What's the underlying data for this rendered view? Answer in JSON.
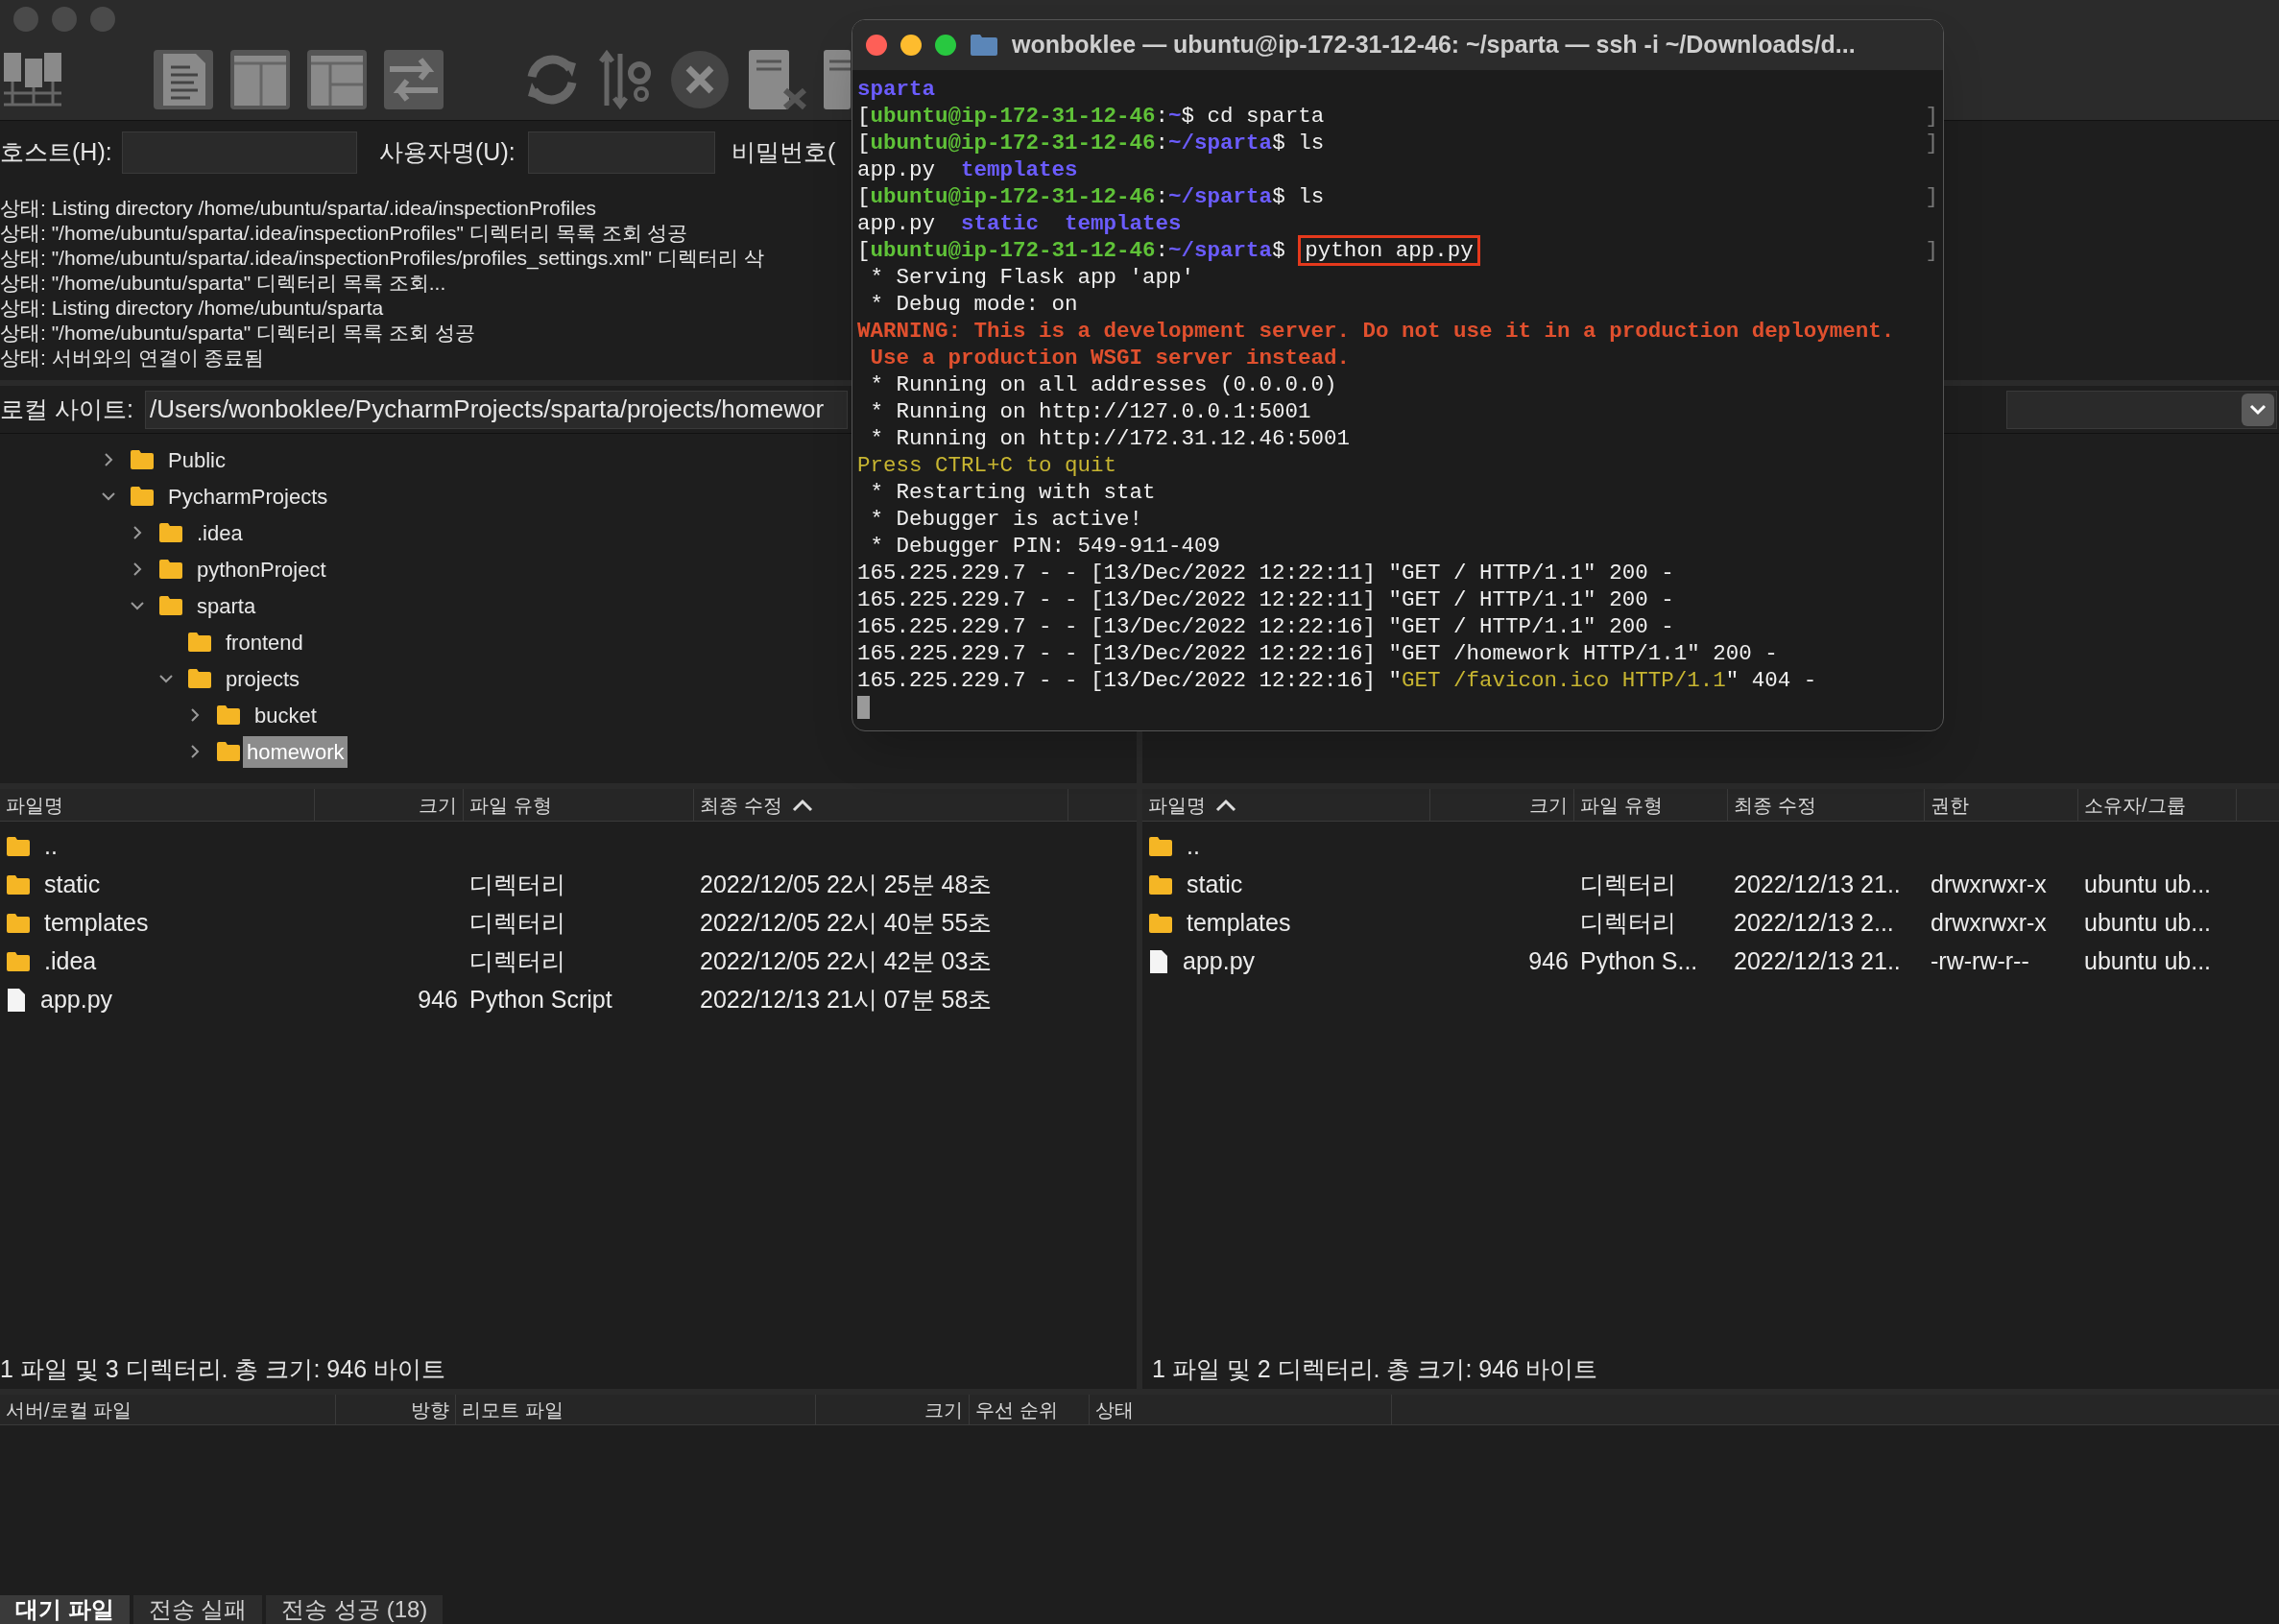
{
  "quickconnect": {
    "host_label": "호스트(H):",
    "user_label": "사용자명(U):",
    "password_label": "비밀번호("
  },
  "log": [
    "상태:  Listing directory /home/ubuntu/sparta/.idea/inspectionProfiles",
    "상태:  \"/home/ubuntu/sparta/.idea/inspectionProfiles\" 디렉터리 목록 조회 성공",
    "상태:  \"/home/ubuntu/sparta/.idea/inspectionProfiles/profiles_settings.xml\" 디렉터리 삭",
    "상태:  \"/home/ubuntu/sparta\" 디렉터리 목록 조회...",
    "상태:  Listing directory /home/ubuntu/sparta",
    "상태:  \"/home/ubuntu/sparta\" 디렉터리 목록 조회 성공",
    "상태:  서버와의 연결이 종료됨"
  ],
  "local_site": {
    "label": "로컬 사이트:",
    "path": "/Users/wonboklee/PycharmProjects/sparta/projects/homewor"
  },
  "local_tree": [
    {
      "name": "Public",
      "expanded": false,
      "selected": false
    },
    {
      "name": "PycharmProjects",
      "expanded": true,
      "selected": false,
      "children": [
        {
          "name": ".idea",
          "expanded": false,
          "selected": false
        },
        {
          "name": "pythonProject",
          "expanded": false,
          "selected": false
        },
        {
          "name": "sparta",
          "expanded": true,
          "selected": false,
          "children": [
            {
              "name": "frontend",
              "selected": false
            },
            {
              "name": "projects",
              "expanded": true,
              "selected": false,
              "children": [
                {
                  "name": "bucket",
                  "expanded": false,
                  "selected": false
                },
                {
                  "name": "homework",
                  "expanded": false,
                  "selected": true
                }
              ]
            }
          ]
        }
      ]
    }
  ],
  "local_files": {
    "columns": [
      {
        "label": "파일명",
        "sorted": false
      },
      {
        "label": "크기",
        "sorted": false
      },
      {
        "label": "파일 유형",
        "sorted": false
      },
      {
        "label": "최종 수정",
        "sorted": true
      }
    ],
    "rows": [
      {
        "kind": "folder",
        "cells": [
          ".."
        ]
      },
      {
        "kind": "folder",
        "cells": [
          "static",
          "",
          "디렉터리",
          "2022/12/05 22시 25분 48초"
        ]
      },
      {
        "kind": "folder",
        "cells": [
          "templates",
          "",
          "디렉터리",
          "2022/12/05 22시 40분 55초"
        ]
      },
      {
        "kind": "folder",
        "cells": [
          ".idea",
          "",
          "디렉터리",
          "2022/12/05 22시 42분 03초"
        ]
      },
      {
        "kind": "file",
        "cells": [
          "app.py",
          "946",
          "Python Script",
          "2022/12/13 21시 07분 58초"
        ]
      }
    ],
    "status": "1 파일 및 3 디렉터리. 총 크기: 946 바이트"
  },
  "remote_files": {
    "columns": [
      {
        "label": "파일명",
        "sorted": true
      },
      {
        "label": "크기",
        "sorted": false
      },
      {
        "label": "파일 유형",
        "sorted": false
      },
      {
        "label": "최종 수정",
        "sorted": false
      },
      {
        "label": "권한",
        "sorted": false
      },
      {
        "label": "소유자/그룹",
        "sorted": false
      }
    ],
    "rows": [
      {
        "kind": "folder",
        "cells": [
          ".."
        ]
      },
      {
        "kind": "folder",
        "cells": [
          "static",
          "",
          "디렉터리",
          "2022/12/13 21..",
          "drwxrwxr-x",
          "ubuntu ub..."
        ]
      },
      {
        "kind": "folder",
        "cells": [
          "templates",
          "",
          "디렉터리",
          "2022/12/13 2...",
          "drwxrwxr-x",
          "ubuntu ub..."
        ]
      },
      {
        "kind": "file",
        "cells": [
          "app.py",
          "946",
          "Python S...",
          "2022/12/13 21..",
          "-rw-rw-r--",
          "ubuntu ub..."
        ]
      }
    ],
    "status": "1 파일 및 2 디렉터리. 총 크기: 946 바이트"
  },
  "queue": {
    "columns": [
      "서버/로컬 파일",
      "방향",
      "리모트 파일",
      "크기",
      "우선 순위",
      "상태"
    ],
    "tabs": [
      {
        "label": "대기 파일",
        "selected": true
      },
      {
        "label": "전송 실패",
        "selected": false
      },
      {
        "label": "전송 성공 (18)",
        "selected": false
      }
    ]
  },
  "terminal": {
    "title": "wonboklee — ubuntu@ip-172-31-12-46: ~/sparta — ssh -i ~/Downloads/d...",
    "lines": [
      {
        "segments": [
          {
            "text": "sparta",
            "kind": "dir"
          }
        ]
      },
      {
        "end": "]",
        "segments": [
          {
            "text": "[",
            "kind": "plain"
          },
          {
            "text": "ubuntu@ip-172-31-12-46",
            "kind": "user"
          },
          {
            "text": ":",
            "kind": "plain"
          },
          {
            "text": "~",
            "kind": "dir"
          },
          {
            "text": "$ cd sparta",
            "kind": "plain"
          }
        ]
      },
      {
        "end": "]",
        "segments": [
          {
            "text": "[",
            "kind": "plain"
          },
          {
            "text": "ubuntu@ip-172-31-12-46",
            "kind": "user"
          },
          {
            "text": ":",
            "kind": "plain"
          },
          {
            "text": "~/sparta",
            "kind": "dir"
          },
          {
            "text": "$ ls",
            "kind": "plain"
          }
        ]
      },
      {
        "segments": [
          {
            "text": "app.py  ",
            "kind": "plain"
          },
          {
            "text": "templates",
            "kind": "dir"
          }
        ]
      },
      {
        "end": "]",
        "segments": [
          {
            "text": "[",
            "kind": "plain"
          },
          {
            "text": "ubuntu@ip-172-31-12-46",
            "kind": "user"
          },
          {
            "text": ":",
            "kind": "plain"
          },
          {
            "text": "~/sparta",
            "kind": "dir"
          },
          {
            "text": "$ ls",
            "kind": "plain"
          }
        ]
      },
      {
        "segments": [
          {
            "text": "app.py  ",
            "kind": "plain"
          },
          {
            "text": "static",
            "kind": "dir"
          },
          {
            "text": "  templates",
            "kind": "dir"
          }
        ]
      },
      {
        "end": "]",
        "segments": [
          {
            "text": "[",
            "kind": "plain"
          },
          {
            "text": "ubuntu@ip-172-31-12-46",
            "kind": "user"
          },
          {
            "text": ":",
            "kind": "plain"
          },
          {
            "text": "~/sparta",
            "kind": "dir"
          },
          {
            "text": "$ ",
            "kind": "plain"
          },
          {
            "text": "python app.py",
            "kind": "boxed"
          }
        ]
      },
      {
        "segments": [
          {
            "text": " * Serving Flask app 'app'",
            "kind": "plain"
          }
        ]
      },
      {
        "segments": [
          {
            "text": " * Debug mode: on",
            "kind": "plain"
          }
        ]
      },
      {
        "segments": [
          {
            "text": "WARNING: This is a development server. Do not use it in a production deployment.",
            "kind": "warning"
          }
        ]
      },
      {
        "segments": [
          {
            "text": " Use a production WSGI server instead.",
            "kind": "warning"
          }
        ]
      },
      {
        "segments": [
          {
            "text": " * Running on all addresses (0.0.0.0)",
            "kind": "plain"
          }
        ]
      },
      {
        "segments": [
          {
            "text": " * Running on http://127.0.0.1:5001",
            "kind": "plain"
          }
        ]
      },
      {
        "segments": [
          {
            "text": " * Running on http://172.31.12.46:5001",
            "kind": "plain"
          }
        ]
      },
      {
        "segments": [
          {
            "text": "Press CTRL+C to quit",
            "kind": "notice"
          }
        ]
      },
      {
        "segments": [
          {
            "text": " * Restarting with stat",
            "kind": "plain"
          }
        ]
      },
      {
        "segments": [
          {
            "text": " * Debugger is active!",
            "kind": "plain"
          }
        ]
      },
      {
        "segments": [
          {
            "text": " * Debugger PIN: 549-911-409",
            "kind": "plain"
          }
        ]
      },
      {
        "segments": [
          {
            "text": "165.225.229.7 - - [13/Dec/2022 12:22:11] \"GET / HTTP/1.1\" 200 -",
            "kind": "plain"
          }
        ]
      },
      {
        "segments": [
          {
            "text": "165.225.229.7 - - [13/Dec/2022 12:22:11] \"GET / HTTP/1.1\" 200 -",
            "kind": "plain"
          }
        ]
      },
      {
        "segments": [
          {
            "text": "165.225.229.7 - - [13/Dec/2022 12:22:16] \"GET / HTTP/1.1\" 200 -",
            "kind": "plain"
          }
        ]
      },
      {
        "segments": [
          {
            "text": "165.225.229.7 - - [13/Dec/2022 12:22:16] \"GET /homework HTTP/1.1\" 200 -",
            "kind": "plain"
          }
        ]
      },
      {
        "segments": [
          {
            "text": "165.225.229.7 - - [13/Dec/2022 12:22:16] \"",
            "kind": "plain"
          },
          {
            "text": "GET /favicon.ico HTTP/1.1",
            "kind": "notice"
          },
          {
            "text": "\" 404 -",
            "kind": "plain"
          }
        ]
      }
    ]
  }
}
